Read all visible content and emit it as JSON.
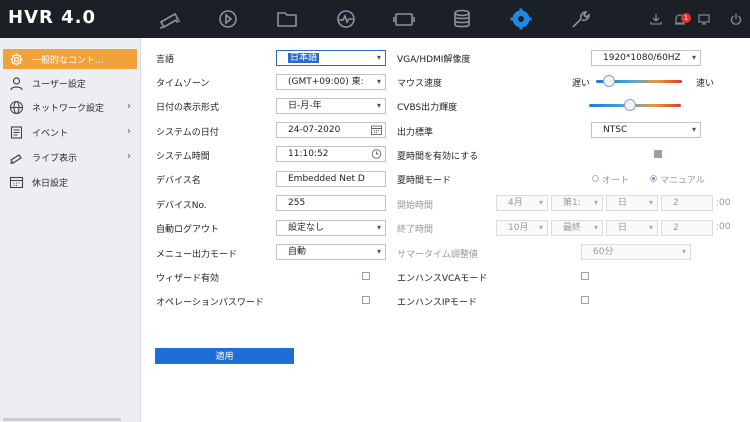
{
  "header": {
    "logo": "HVR 4.0",
    "notification_count": "1"
  },
  "nav": [
    {
      "icon": "live-view-camera-icon"
    },
    {
      "icon": "playback-icon"
    },
    {
      "icon": "file-folder-icon"
    },
    {
      "icon": "smart-analysis-icon"
    },
    {
      "icon": "camera-management-icon"
    },
    {
      "icon": "storage-icon"
    },
    {
      "icon": "configuration-gear-icon",
      "active": true
    },
    {
      "icon": "maintenance-wrench-icon"
    }
  ],
  "sidebar": {
    "items": [
      {
        "label": "一般的なコント...",
        "icon": "gear-icon",
        "active": true
      },
      {
        "label": "ユーザー設定",
        "icon": "user-icon"
      },
      {
        "label": "ネットワーク設定",
        "icon": "globe-icon",
        "chevron": "›"
      },
      {
        "label": "イベント",
        "icon": "event-icon",
        "chevron": "›"
      },
      {
        "label": "ライブ表示",
        "icon": "live-view-icon",
        "chevron": "›"
      },
      {
        "label": "休日設定",
        "icon": "calendar-icon"
      }
    ]
  },
  "left_form": {
    "language": {
      "label": "言語",
      "value": "日本語"
    },
    "timezone": {
      "label": "タイムゾーン",
      "value": "(GMT+09:00) 東:"
    },
    "date_format": {
      "label": "日付の表示形式",
      "value": "日-月-年"
    },
    "system_date": {
      "label": "システムの日付",
      "value": "24-07-2020"
    },
    "system_time": {
      "label": "システム時間",
      "value": "11:10:52"
    },
    "device_name": {
      "label": "デバイス名",
      "value": "Embedded Net D"
    },
    "device_no": {
      "label": "デバイスNo.",
      "value": "255"
    },
    "auto_logout": {
      "label": "自動ログアウト",
      "value": "設定なし"
    },
    "menu_output_mode": {
      "label": "メニュー出力モード",
      "value": "自動"
    },
    "wizard_enabled": {
      "label": "ウィザード有効"
    },
    "operation_password": {
      "label": "オペレーションパスワード"
    }
  },
  "right_form": {
    "vga_resolution": {
      "label": "VGA/HDMI解像度",
      "value": "1920*1080/60HZ"
    },
    "mouse_speed": {
      "label": "マウス速度",
      "slow": "遅い",
      "fast": "速い",
      "level": 0.15
    },
    "cvbs_brightness": {
      "label": "CVBS出力輝度",
      "level": 0.45
    },
    "output_standard": {
      "label": "出力標準",
      "value": "NTSC"
    },
    "dst_enable": {
      "label": "夏時間を有効にする"
    },
    "dst_mode": {
      "label": "夏時間モード",
      "auto": "オート",
      "manual": "マニュアル"
    },
    "start_time": {
      "label": "開始時間",
      "month": "4月",
      "week": "第1:",
      "day": "日",
      "hour": "2",
      "suffix": ":00"
    },
    "end_time": {
      "label": "終了時間",
      "month": "10月",
      "week": "最終",
      "day": "日",
      "hour": "2",
      "suffix": ":00"
    },
    "dst_bias": {
      "label": "サマータイム調整値",
      "value": "60分"
    },
    "enhanced_vca": {
      "label": "エンハンスVCAモード"
    },
    "enhanced_ip": {
      "label": "エンハンスIPモード"
    }
  },
  "apply_button": {
    "label": "適用"
  },
  "icons": {
    "dropdown": "▾",
    "chevron": "›"
  }
}
